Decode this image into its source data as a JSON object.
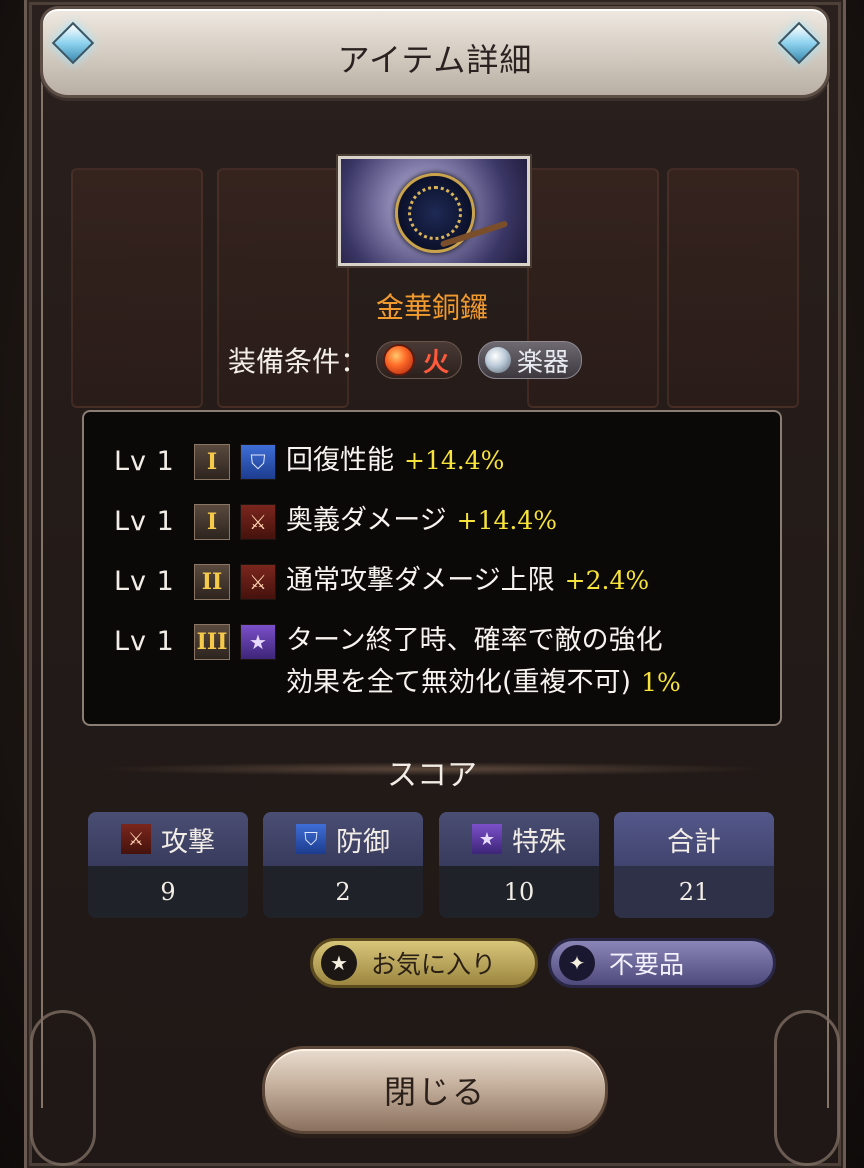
{
  "header": {
    "title": "アイテム詳細"
  },
  "item": {
    "name": "金華銅鑼",
    "equip_label": "装備条件：",
    "requirements": [
      {
        "label": "火",
        "icon": "fire-orb-icon"
      },
      {
        "label": "楽器",
        "icon": "instrument-icon"
      }
    ]
  },
  "effects": [
    {
      "level": "Lv 1",
      "tier": "I",
      "category": "heal",
      "icon": "shield-icon",
      "text": "回復性能",
      "value": "+14.4%"
    },
    {
      "level": "Lv 1",
      "tier": "I",
      "category": "attack",
      "icon": "crossed-swords-icon",
      "text": "奥義ダメージ",
      "value": "+14.4%"
    },
    {
      "level": "Lv 1",
      "tier": "II",
      "category": "attack",
      "icon": "crossed-swords-icon",
      "text": "通常攻撃ダメージ上限",
      "value": "+2.4%"
    },
    {
      "level": "Lv 1",
      "tier": "III",
      "category": "special",
      "icon": "star-icon",
      "text_line1": "ターン終了時、確率で敵の強化",
      "text_line2": "効果を全て無効化(重複不可)",
      "value": "1%"
    }
  ],
  "score": {
    "title": "スコア",
    "cards": [
      {
        "label": "攻撃",
        "value": "9",
        "icon": "crossed-swords-icon"
      },
      {
        "label": "防御",
        "value": "2",
        "icon": "shield-icon"
      },
      {
        "label": "特殊",
        "value": "10",
        "icon": "star-icon"
      },
      {
        "label": "合計",
        "value": "21"
      }
    ]
  },
  "actions": {
    "favorite_label": "お気に入り",
    "junk_label": "不要品"
  },
  "close_label": "閉じる",
  "colors": {
    "item_name": "#f19a2e",
    "effect_value": "#f7e33a",
    "tier_numeral": "#f5c94a"
  }
}
